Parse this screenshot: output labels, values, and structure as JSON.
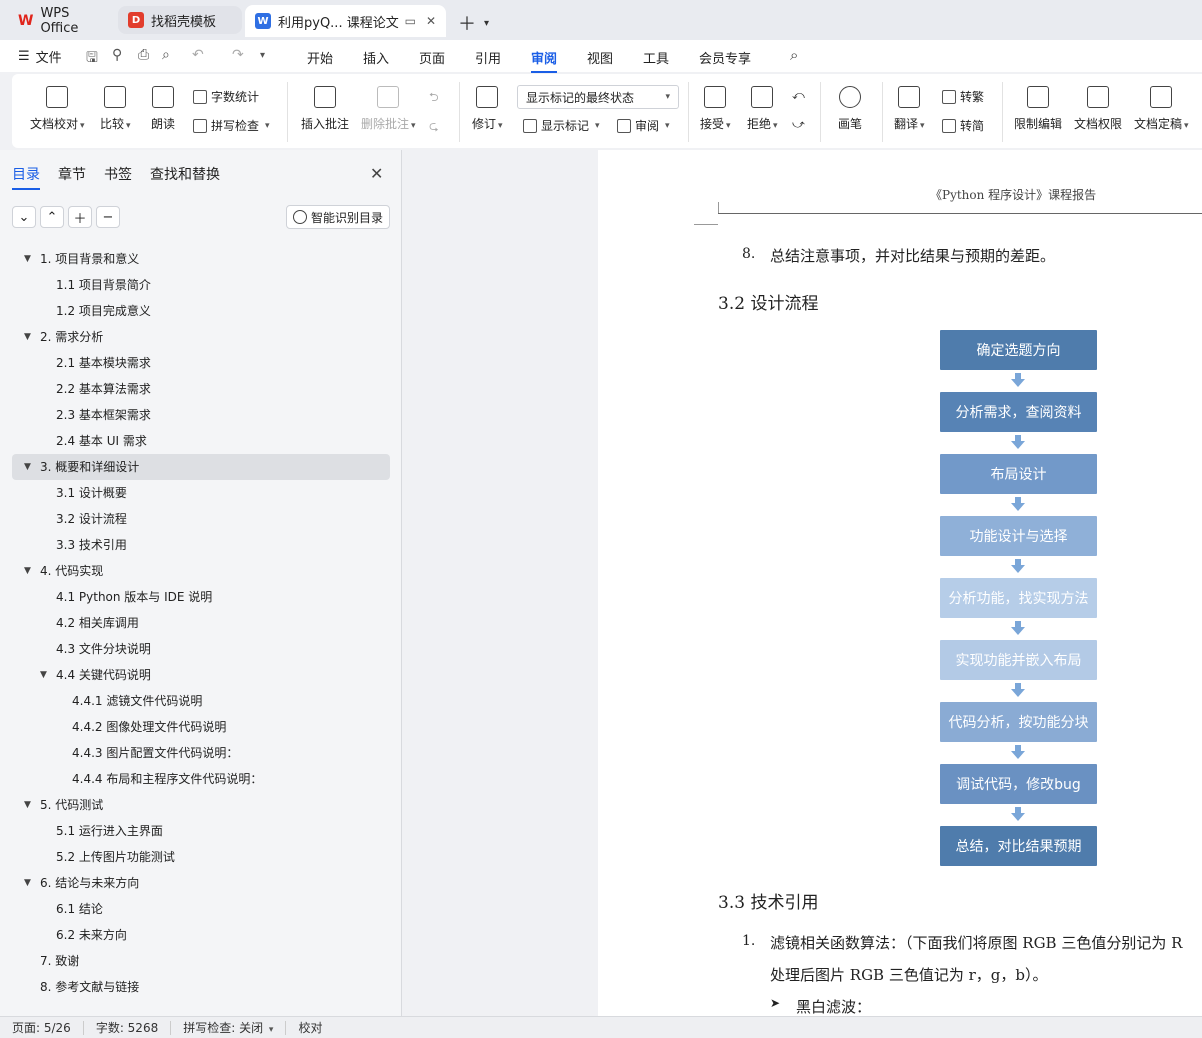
{
  "tabs": {
    "wps": "WPS Office",
    "template": "找稻壳模板",
    "document": "利用pyQ... 课程论文"
  },
  "menu": {
    "file": "文件",
    "items": [
      "开始",
      "插入",
      "页面",
      "引用",
      "审阅",
      "视图",
      "工具",
      "会员专享"
    ],
    "active": "审阅"
  },
  "ribbon": {
    "doc_check": "文档校对",
    "compare": "比较",
    "read_aloud": "朗读",
    "word_count": "字数统计",
    "spell_check": "拼写检查",
    "insert_comment": "插入批注",
    "delete_comment": "删除批注",
    "track_changes": "修订",
    "show_markup_state": "显示标记的最终状态",
    "show_markup": "显示标记",
    "review": "审阅",
    "accept": "接受",
    "reject": "拒绝",
    "pen": "画笔",
    "translate": "翻译",
    "to_traditional": "转繁",
    "to_simplified": "转简",
    "restrict_edit": "限制编辑",
    "doc_permission": "文档权限",
    "finalize": "文档定稿"
  },
  "panel": {
    "tabs": [
      "目录",
      "章节",
      "书签",
      "查找和替换"
    ],
    "smart_toc": "智能识别目录",
    "toc": [
      {
        "text": "1.  项目背景和意义",
        "level": 1,
        "expanded": true
      },
      {
        "text": "1.1  项目背景简介",
        "level": 2
      },
      {
        "text": "1.2  项目完成意义",
        "level": 2
      },
      {
        "text": "2.  需求分析",
        "level": 1,
        "expanded": true
      },
      {
        "text": "2.1  基本模块需求",
        "level": 2
      },
      {
        "text": "2.2  基本算法需求",
        "level": 2
      },
      {
        "text": "2.3  基本框架需求",
        "level": 2
      },
      {
        "text": "2.4  基本 UI 需求",
        "level": 2
      },
      {
        "text": "3.  概要和详细设计",
        "level": 1,
        "expanded": true,
        "selected": true
      },
      {
        "text": "3.1  设计概要",
        "level": 2
      },
      {
        "text": "3.2  设计流程",
        "level": 2
      },
      {
        "text": "3.3  技术引用",
        "level": 2
      },
      {
        "text": "4.  代码实现",
        "level": 1,
        "expanded": true
      },
      {
        "text": "4.1 Python 版本与 IDE 说明",
        "level": 2
      },
      {
        "text": "4.2  相关库调用",
        "level": 2
      },
      {
        "text": "4.3  文件分块说明",
        "level": 2
      },
      {
        "text": "4.4  关键代码说明",
        "level": 2,
        "expanded": true
      },
      {
        "text": "4.4.1  滤镜文件代码说明",
        "level": 3
      },
      {
        "text": "4.4.2  图像处理文件代码说明",
        "level": 3
      },
      {
        "text": "4.4.3  图片配置文件代码说明：",
        "level": 3
      },
      {
        "text": "4.4.4  布局和主程序文件代码说明：",
        "level": 3
      },
      {
        "text": "5.  代码测试",
        "level": 1,
        "expanded": true
      },
      {
        "text": "5.1  运行进入主界面",
        "level": 2
      },
      {
        "text": "5.2  上传图片功能测试",
        "level": 2
      },
      {
        "text": "6.  结论与未来方向",
        "level": 1,
        "expanded": true
      },
      {
        "text": "6.1  结论",
        "level": 2
      },
      {
        "text": "6.2  未来方向",
        "level": 2
      },
      {
        "text": "7.  致谢",
        "level": 1
      },
      {
        "text": "8.  参考文献与链接",
        "level": 1
      }
    ]
  },
  "document": {
    "header": "《Python 程序设计》课程报告",
    "item8_num": "8.",
    "item8_text": "总结注意事项，并对比结果与预期的差距。",
    "sec32": "3.2  设计流程",
    "flow": [
      {
        "text": "确定选题方向",
        "color": "#4f7cac"
      },
      {
        "text": "分析需求，查阅资料",
        "color": "#5783b5"
      },
      {
        "text": "布局设计",
        "color": "#7299c9"
      },
      {
        "text": "功能设计与选择",
        "color": "#8fb0d8"
      },
      {
        "text": "分析功能，找实现方法",
        "color": "#b6cde8"
      },
      {
        "text": "实现功能并嵌入布局",
        "color": "#b3cae6"
      },
      {
        "text": "代码分析，按功能分块",
        "color": "#8aabd4"
      },
      {
        "text": "调试代码，修改bug",
        "color": "#6a91c2"
      },
      {
        "text": "总结，对比结果预期",
        "color": "#4f7cac"
      }
    ],
    "sec33": "3.3  技术引用",
    "item1_num": "1.",
    "item1_line1": "滤镜相关函数算法：（下面我们将原图 RGB 三色值分别记为 R",
    "item1_line2": "处理后图片 RGB 三色值记为 r，g，b）。",
    "bullet_text": "黑白滤波："
  },
  "status": {
    "page": "页面: 5/26",
    "words": "字数: 5268",
    "spell": "拼写检查: 关闭",
    "proof": "校对"
  }
}
